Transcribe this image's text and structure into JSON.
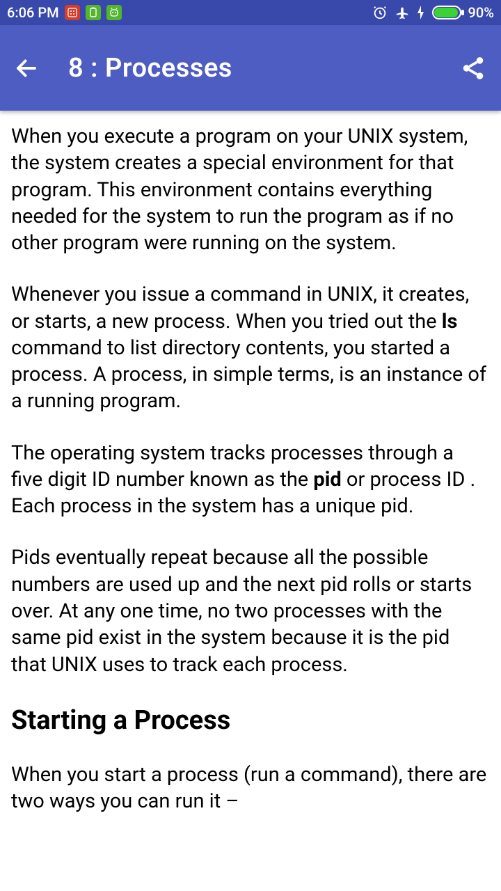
{
  "status": {
    "time": "6:06 PM",
    "battery_pct": "90%"
  },
  "appbar": {
    "title": "8 : Processes"
  },
  "content": {
    "p1_a": "When you execute a program on your UNIX system, the system creates a special environment for that program. This environment contains everything needed for the system to run the program as if no other program were running on the system.",
    "p2_a": "Whenever you issue a command in UNIX, it creates, or starts, a new process. When you tried out the ",
    "p2_bold": "ls",
    "p2_b": " command to list directory contents, you started a process. A process, in simple terms, is an instance of a running program.",
    "p3_a": "The operating system tracks processes through a five digit ID number known as the ",
    "p3_bold": "pid",
    "p3_b": " or process ID . Each process in the system has a unique pid.",
    "p4": "Pids eventually repeat because all the possible numbers are used up and the next pid rolls or starts over. At any one time, no two processes with the same pid exist in the system because it is the pid that UNIX uses to track each process.",
    "h2": "Starting a Process",
    "p5": "When you start a process (run a command), there are two ways you can run it –"
  }
}
